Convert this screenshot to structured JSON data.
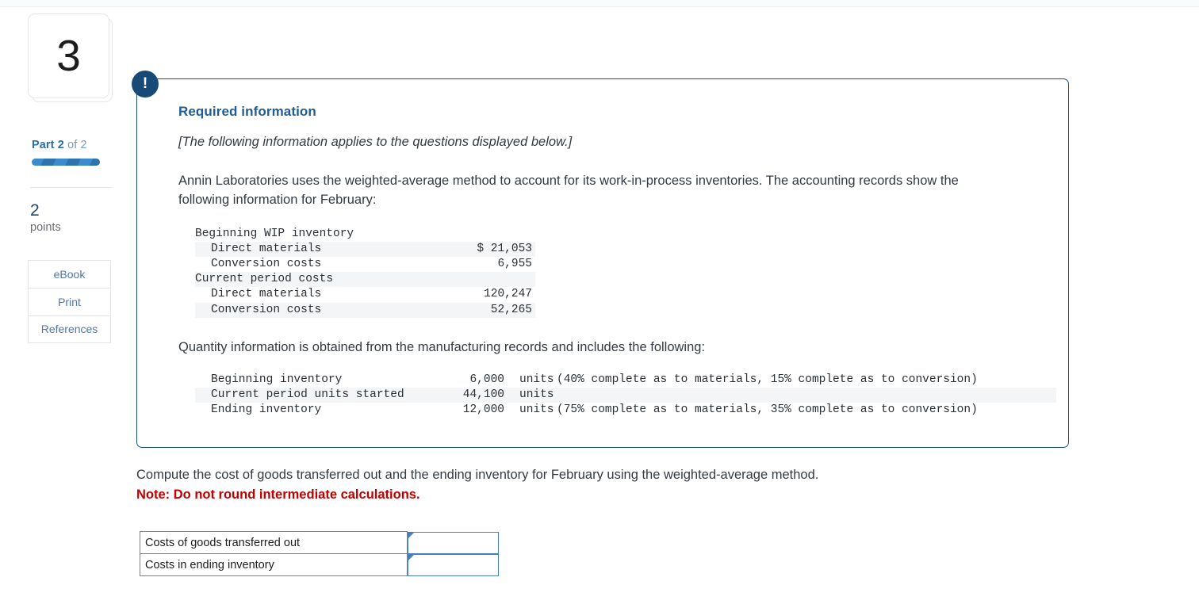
{
  "rail": {
    "question_number": "3",
    "part_prefix": "Part",
    "part_current": "2",
    "part_of": "of 2",
    "points_number": "2",
    "points_label": "points",
    "buttons": [
      {
        "label": "eBook"
      },
      {
        "label": "Print"
      },
      {
        "label": "References"
      }
    ]
  },
  "callout": {
    "icon": "exclamation-icon",
    "bang": "!",
    "title": "Required information",
    "italic_note": "[The following information applies to the questions displayed below.]",
    "paragraph": "Annin Laboratories uses the weighted-average method to account for its work-in-process inventories. The accounting records show the following information for February:",
    "paragraph2": "Quantity information is obtained from the manufacturing records and includes the following:",
    "cost_table": [
      {
        "label": "Beginning WIP inventory",
        "value": "",
        "indent": false,
        "shaded": false
      },
      {
        "label": "Direct materials",
        "value": "$ 21,053",
        "indent": true,
        "shaded": true
      },
      {
        "label": "Conversion costs",
        "value": "6,955",
        "indent": true,
        "shaded": false
      },
      {
        "label": "Current period costs",
        "value": "",
        "indent": false,
        "shaded": true
      },
      {
        "label": "Direct materials",
        "value": "120,247",
        "indent": true,
        "shaded": false
      },
      {
        "label": "Conversion costs",
        "value": "52,265",
        "indent": true,
        "shaded": true
      }
    ],
    "qty_table": [
      {
        "label": "Beginning inventory",
        "value": "6,000",
        "unit": "units",
        "note": "(40% complete as to materials, 15% complete as to conversion)",
        "shaded": false
      },
      {
        "label": "Current period units started",
        "value": "44,100",
        "unit": "units",
        "note": "",
        "shaded": true
      },
      {
        "label": "Ending inventory",
        "value": "12,000",
        "unit": "units",
        "note": "(75% complete as to materials, 35% complete as to conversion)",
        "shaded": false
      }
    ]
  },
  "prompt": {
    "main": "Compute the cost of goods transferred out and the ending inventory for February using the weighted-average method.",
    "note": "Note: Do not round intermediate calculations."
  },
  "answers": {
    "rows": [
      {
        "label": "Costs of goods transferred out",
        "value": "",
        "placeholder": ""
      },
      {
        "label": "Costs in ending inventory",
        "value": "",
        "placeholder": ""
      }
    ]
  },
  "colors": {
    "accent_blue": "#2c6ca8",
    "callout_border": "#1c4d7c",
    "bang_bg": "#174a77",
    "note_red": "#c00000",
    "input_border": "#4a7ebb",
    "shade_row": "#f4f5f6"
  }
}
